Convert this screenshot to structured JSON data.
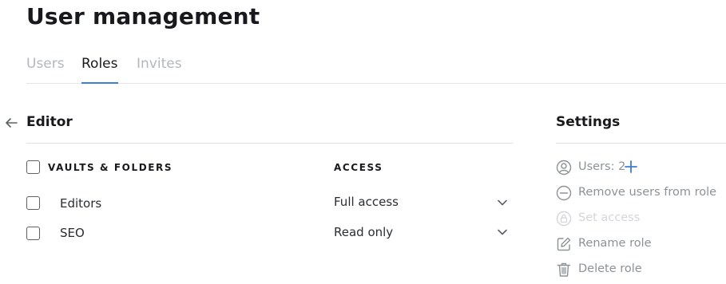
{
  "header": {
    "title": "User management"
  },
  "tabs": [
    {
      "label": "Users",
      "active": false
    },
    {
      "label": "Roles",
      "active": true
    },
    {
      "label": "Invites",
      "active": false
    }
  ],
  "role": {
    "name": "Editor",
    "columns": {
      "vaults": "VAULTS & FOLDERS",
      "access": "ACCESS"
    },
    "rows": [
      {
        "name": "Editors",
        "access": "Full access"
      },
      {
        "name": "SEO",
        "access": "Read only"
      }
    ]
  },
  "settings": {
    "title": "Settings",
    "users_label": "Users: 2",
    "remove_label": "Remove users from role",
    "set_access_label": "Set access",
    "rename_label": "Rename role",
    "delete_label": "Delete role"
  },
  "colors": {
    "accent": "#3b7dd8",
    "muted": "#8d9297",
    "disabled": "#d3d6da"
  },
  "icons": [
    "arrow-left-icon",
    "chevron-down-icon",
    "user-circle-icon",
    "plus-icon",
    "minus-circle-icon",
    "lock-icon",
    "edit-icon",
    "trash-icon"
  ]
}
